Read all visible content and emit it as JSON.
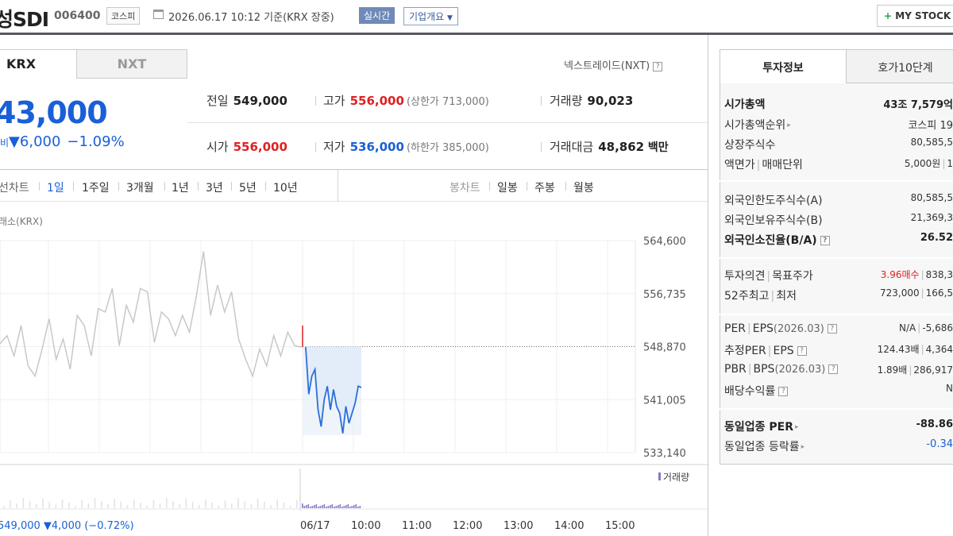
{
  "header": {
    "title": "성SDI",
    "code": "006400",
    "market": "코스피",
    "datetime": "2026.06.17 10:12 기준(KRX 장중)",
    "realtime": "실시간",
    "overview": "기업개요",
    "mystock": "MY STOCK"
  },
  "tabs": {
    "krx": "KRX",
    "nxt": "NXT"
  },
  "nextrade": "넥스트레이드(NXT)",
  "price": {
    "current": "43,000",
    "change_label": "비",
    "change": "▼6,000",
    "change_pct": "−1.09%"
  },
  "info": {
    "prev_close_label": "전일",
    "prev_close": "549,000",
    "high_label": "고가",
    "high": "556,000",
    "upper_limit": "(상한가 713,000)",
    "volume_label": "거래량",
    "volume": "90,023",
    "open_label": "시가",
    "open": "556,000",
    "low_label": "저가",
    "low": "536,000",
    "lower_limit": "(하한가 385,000)",
    "amount_label": "거래대금",
    "amount": "48,862",
    "amount_unit": "백만"
  },
  "periods": {
    "line_chart": "선차트",
    "items": [
      "1일",
      "1주일",
      "3개월",
      "1년",
      "3년",
      "5년",
      "10년"
    ],
    "candle_chart": "봉차트",
    "candle_items": [
      "일봉",
      "주봉",
      "월봉"
    ]
  },
  "chart_label": "래소(KRX)",
  "chart_data": {
    "type": "line",
    "y_ticks": [
      "564,600",
      "556,735",
      "548,870",
      "541,005",
      "533,140"
    ],
    "y_tick_values": [
      564600,
      556735,
      548870,
      541005,
      533140
    ],
    "x_ticks": [
      "06/17",
      "10:00",
      "11:00",
      "12:00",
      "13:00",
      "14:00",
      "15:00"
    ],
    "prev_close": 548870,
    "volume_label": "거래량",
    "bottom_summary": "549,000 ▼4,000 (−0.72%)",
    "series": [
      {
        "values": [
          549300,
          550500,
          547500,
          552000,
          546000,
          544500,
          548500,
          553000,
          547000,
          550000,
          545500,
          553500,
          552000,
          547500,
          554500,
          554000,
          557500,
          549000,
          555000,
          552500,
          557500,
          557000,
          549500,
          554000,
          553000,
          550500,
          553500,
          551000,
          556500,
          563000,
          553500,
          558000,
          554000,
          557000,
          550000,
          547000,
          544500,
          548500,
          546000,
          550500,
          547500,
          551000,
          549000,
          548800
        ]
      },
      {
        "values": [
          552000,
          548800,
          541800,
          544500,
          545500,
          539500,
          537000,
          541000,
          543000,
          539500,
          542500,
          540000,
          539000,
          536000,
          540000,
          537500,
          539000,
          540500,
          543000,
          542800
        ]
      }
    ]
  },
  "invest": {
    "tabs": [
      "투자정보",
      "호가10단계"
    ],
    "rows": [
      {
        "k": "시가총액",
        "v": "43조 7,579억"
      },
      {
        "k": "시가총액순위",
        "v": "코스피 19"
      },
      {
        "k": "상장주식수",
        "v": "80,585,5"
      },
      {
        "k": "액면가",
        "k2": "매매단위",
        "v": "5,000원",
        "v2": "1"
      },
      {
        "k": "외국인한도주식수(A)",
        "v": "80,585,5"
      },
      {
        "k": "외국인보유주식수(B)",
        "v": "21,369,3"
      },
      {
        "k": "외국인소진율(B/A)",
        "v": "26.52"
      },
      {
        "k": "투자의견",
        "k2": "목표주가",
        "v": "3.96매수",
        "v2": "838,3"
      },
      {
        "k": "52주최고",
        "k2": "최저",
        "v": "723,000",
        "v2": "166,5"
      },
      {
        "k": "PER",
        "k2": "EPS",
        "k3": "(2026.03)",
        "v": "N/A",
        "v2": "-5,686"
      },
      {
        "k": "추정PER",
        "k2": "EPS",
        "v": "124.43배",
        "v2": "4,364"
      },
      {
        "k": "PBR",
        "k2": "BPS",
        "k3": "(2026.03)",
        "v": "1.89배",
        "v2": "286,917"
      },
      {
        "k": "배당수익률",
        "v": "N"
      },
      {
        "k": "동일업종 PER",
        "v": "-88.86"
      },
      {
        "k": "동일업종 등락률",
        "v": "-0.34"
      }
    ]
  }
}
